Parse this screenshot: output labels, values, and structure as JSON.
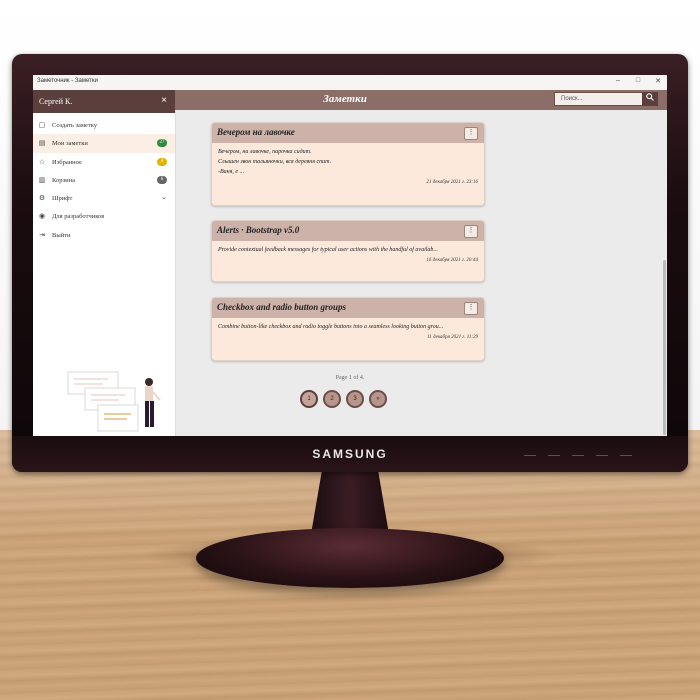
{
  "window": {
    "title": "Заметочник - Заметки",
    "minimize": "–",
    "maximize": "□",
    "close": "✕"
  },
  "sidebar": {
    "user": "Сергей К.",
    "close_icon": "×",
    "items": [
      {
        "icon": "note-add-icon",
        "glyph": "▢",
        "label": "Создать заметку"
      },
      {
        "icon": "notes-icon",
        "glyph": "▤",
        "label": "Мои заметки",
        "badge": "27",
        "badge_color": "#2e8b3a"
      },
      {
        "icon": "star-icon",
        "glyph": "☆",
        "label": "Избранное",
        "badge": "4",
        "badge_color": "#e0b400"
      },
      {
        "icon": "trash-icon",
        "glyph": "▥",
        "label": "Корзина",
        "badge": "6",
        "badge_color": "#666666"
      },
      {
        "icon": "gear-icon",
        "glyph": "⚙",
        "label": "Шрифт",
        "chevron": "⌄"
      },
      {
        "icon": "user-circle-icon",
        "glyph": "◉",
        "label": "Для разработчиков"
      },
      {
        "icon": "logout-icon",
        "glyph": "⇥",
        "label": "Выйти"
      }
    ]
  },
  "appbar": {
    "title": "Заметки",
    "search_placeholder": "Поиск...",
    "search_icon": "search-icon"
  },
  "notes": [
    {
      "title": "Вечером на лавочке",
      "menu": "⋮",
      "lines": [
        "Вечером, на лавочке, парочка сидит.",
        "Слышен звон тальяночки, вся деревня спит.",
        "-Ваня, е ..."
      ],
      "date": "21 декабря 2021 г. 23:16"
    },
    {
      "title": "Alerts · Bootstrap v5.0",
      "menu": "⋮",
      "lines": [
        "Provide contextual feedback messages for typical user actions with the handful of availab..."
      ],
      "date": "16 декабря 2021 г. 20:44"
    },
    {
      "title": "Checkbox and radio button groups",
      "menu": "⋮",
      "lines": [
        "Combine button-like checkbox and radio toggle buttons into a seamless looking button grou..."
      ],
      "date": "11 декабря 2021 г. 11:29"
    }
  ],
  "pagination": {
    "info": "Page 1 of 4.",
    "pages": [
      "1",
      "2",
      "3",
      "»"
    ],
    "current": "1"
  },
  "fab_icon": "add-note-icon",
  "monitor": {
    "brand": "SAMSUNG"
  },
  "colors": {
    "accent": "#5b3f3c",
    "appbar": "#8c6e69",
    "card_header": "#cdb2a9",
    "card_body": "#fde9dc"
  }
}
